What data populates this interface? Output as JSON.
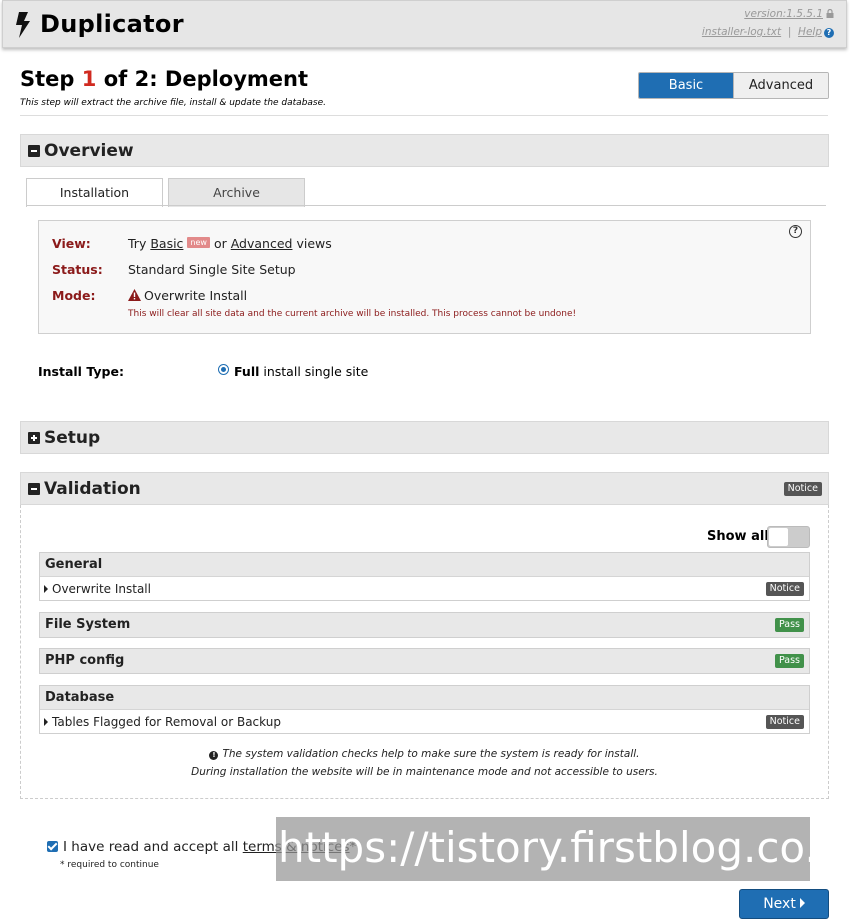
{
  "header": {
    "title": "Duplicator",
    "version": "version:1.5.5.1",
    "log_link": "installer-log.txt",
    "separator": "|",
    "help_link": "Help"
  },
  "step": {
    "prefix": "Step",
    "number": "1",
    "suffix": "of 2: Deployment",
    "subtitle": "This step will extract the archive file, install & update the database."
  },
  "view_toggle": {
    "basic": "Basic",
    "advanced": "Advanced",
    "selected": "Basic"
  },
  "overview": {
    "heading": "Overview",
    "tabs": [
      {
        "label": "Installation",
        "active": true
      },
      {
        "label": "Archive",
        "active": false
      }
    ],
    "view_key": "View:",
    "view_try": "Try",
    "view_basic": "Basic",
    "view_new_badge": "new",
    "view_or": "or",
    "view_advanced": "Advanced",
    "view_views": "views",
    "status_key": "Status:",
    "status_val": "Standard Single Site Setup",
    "mode_key": "Mode:",
    "mode_val": "Overwrite Install",
    "mode_warning": "This will clear all site data and the current archive will be installed. This process cannot be undone!",
    "help_glyph": "?"
  },
  "install_type": {
    "label": "Install Type:",
    "value_bold": "Full",
    "value_rest": "install single site",
    "selected": true
  },
  "setup": {
    "heading": "Setup"
  },
  "validation": {
    "heading": "Validation",
    "status_badge": "Notice",
    "show_all_label": "Show all",
    "show_all_on": false,
    "groups": [
      {
        "title": "General",
        "items": [
          {
            "label": "Overwrite Install",
            "badge": "Notice"
          }
        ]
      },
      {
        "title": "File System",
        "badge": "Pass"
      },
      {
        "title": "PHP config",
        "badge": "Pass"
      },
      {
        "title": "Database",
        "items": [
          {
            "label": "Tables Flagged for Removal or Backup",
            "badge": "Notice"
          }
        ]
      }
    ],
    "note_line1": "The system validation checks help to make sure the system is ready for install.",
    "note_line2": "During installation the website will be in maintenance mode and not accessible to users."
  },
  "accept": {
    "text_before": "I have read and accept all",
    "link": "terms & notices",
    "asterisk": "*",
    "required": "* required to continue",
    "checked": true
  },
  "watermark": "https://tistory.firstblog.co.kr",
  "next_button": "Next",
  "colors": {
    "accent": "#1f6eb3",
    "step_number": "#d02a20",
    "warning": "#8b1a1a",
    "pass": "#41914a",
    "notice": "#555555"
  }
}
